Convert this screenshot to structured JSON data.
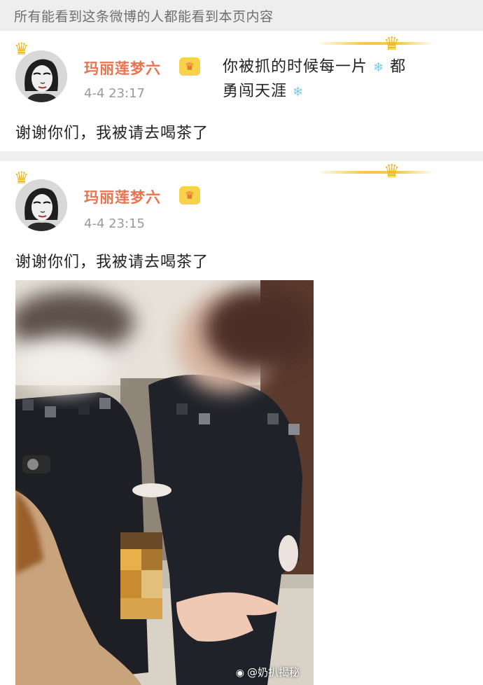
{
  "visibility_notice": "所有能看到这条微博的人都能看到本页内容",
  "posts": [
    {
      "username": "玛丽莲梦六",
      "timestamp": "4-4 23:17",
      "card_text_line1": "你被抓的时候每一片",
      "card_text_line2_tail": "都",
      "card_text_line3": "勇闯天涯",
      "body": "谢谢你们，我被请去喝茶了"
    },
    {
      "username": "玛丽莲梦六",
      "timestamp": "4-4 23:15",
      "body": "谢谢你们，我被请去喝茶了"
    }
  ],
  "watermark": "@奶扒揭秘",
  "icons": {
    "crown": "crown-icon",
    "vip": "vip-badge-icon",
    "snowflake": "snowflake-icon",
    "weibo_logo": "weibo-logo-icon"
  },
  "colors": {
    "username": "#eb7350",
    "timestamp": "#9a9a9a",
    "crown": "#f0b922",
    "notice_bg": "#eeeeee"
  }
}
